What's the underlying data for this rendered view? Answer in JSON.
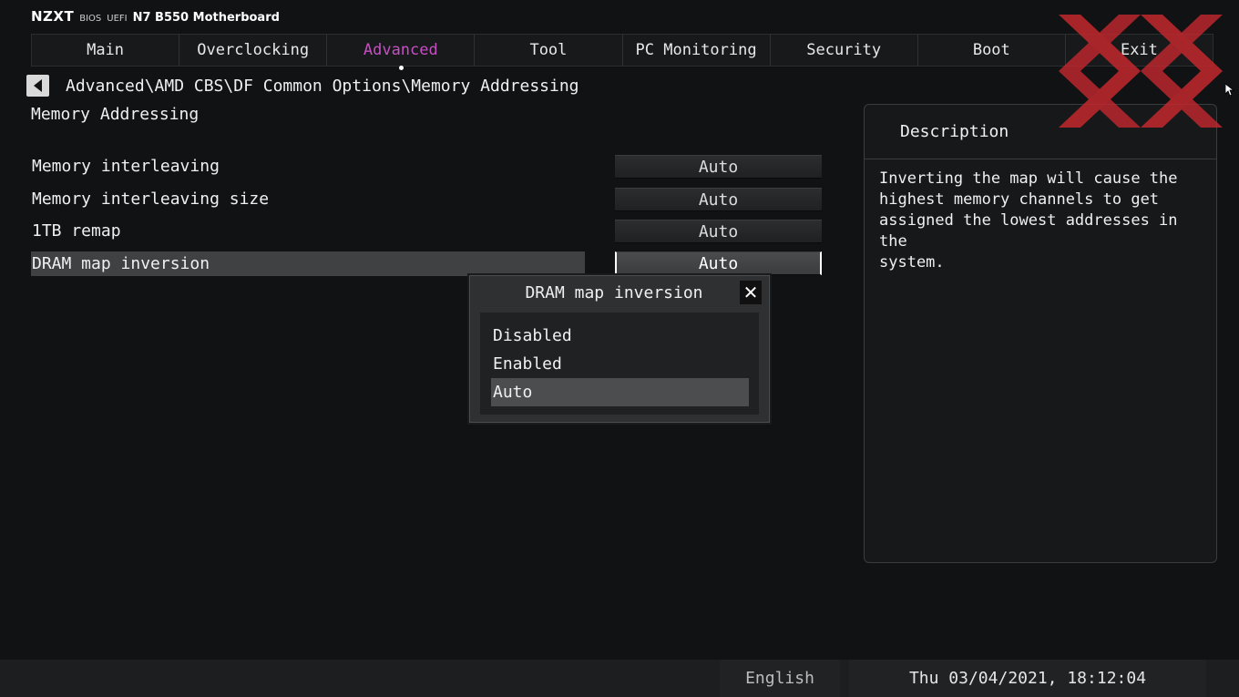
{
  "brand": {
    "logo": "NZXT",
    "bios": "BIOS",
    "uefi": "UEFI",
    "model": "N7 B550 Motherboard"
  },
  "tabs": [
    {
      "label": "Main"
    },
    {
      "label": "Overclocking"
    },
    {
      "label": "Advanced",
      "active": true
    },
    {
      "label": "Tool"
    },
    {
      "label": "PC Monitoring"
    },
    {
      "label": "Security"
    },
    {
      "label": "Boot"
    },
    {
      "label": "Exit"
    }
  ],
  "breadcrumb": "Advanced\\AMD CBS\\DF Common Options\\Memory Addressing",
  "section_title": "Memory Addressing",
  "settings": [
    {
      "label": "Memory interleaving",
      "value": "Auto"
    },
    {
      "label": "Memory interleaving size",
      "value": "Auto"
    },
    {
      "label": "1TB remap",
      "value": "Auto"
    },
    {
      "label": "DRAM map inversion",
      "value": "Auto",
      "selected": true
    }
  ],
  "description": {
    "title": "Description",
    "text": "Inverting the map will cause the\nhighest memory channels to get\nassigned the lowest addresses in the\nsystem."
  },
  "popup": {
    "title": "DRAM map inversion",
    "close_icon": "close-icon",
    "options": [
      "Disabled",
      "Enabled",
      "Auto"
    ],
    "selected": "Auto"
  },
  "footer": {
    "language": "English",
    "datetime": "Thu 03/04/2021, 18:12:04"
  },
  "colors": {
    "accent": "#c74fc4",
    "watermark": "#c8282e"
  }
}
